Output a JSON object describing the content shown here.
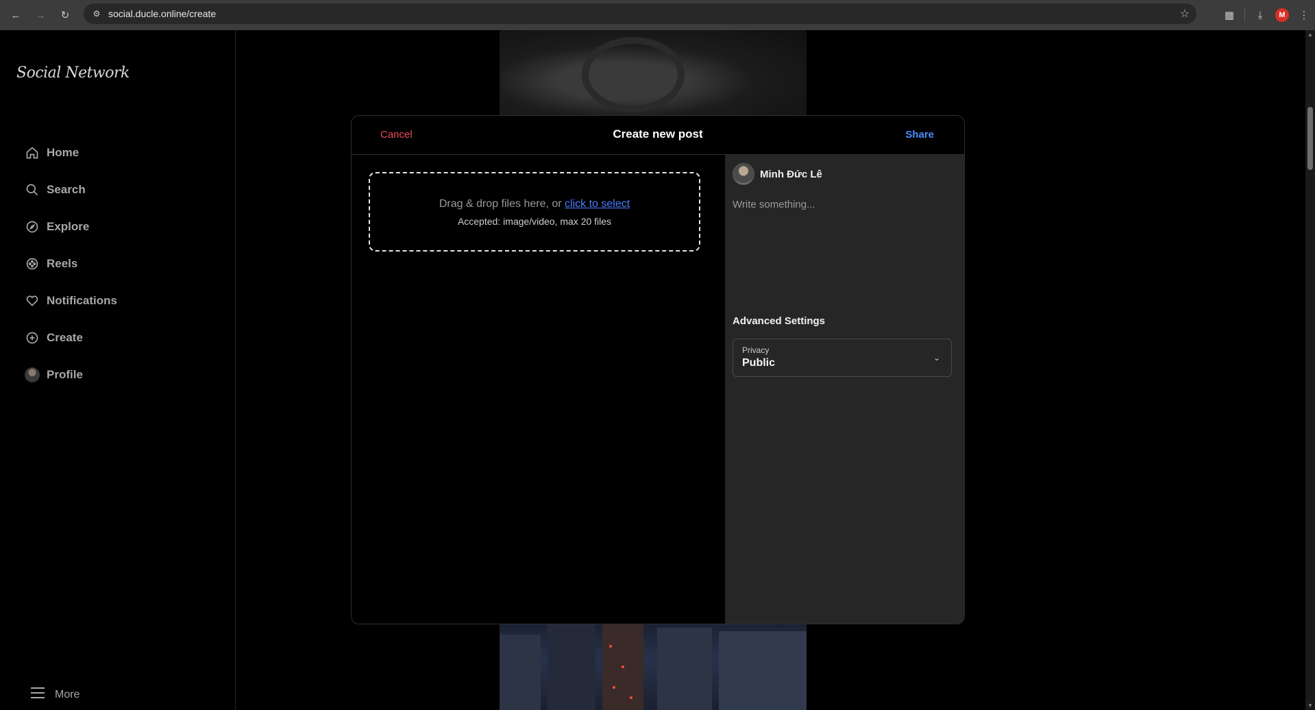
{
  "browser": {
    "url": "social.ducle.online/create",
    "profile_initial": "M"
  },
  "sidebar": {
    "logo": "Social Network",
    "items": [
      {
        "label": "Home"
      },
      {
        "label": "Search"
      },
      {
        "label": "Explore"
      },
      {
        "label": "Reels"
      },
      {
        "label": "Notifications"
      },
      {
        "label": "Create"
      },
      {
        "label": "Profile"
      }
    ],
    "more_label": "More"
  },
  "modal": {
    "cancel_label": "Cancel",
    "title": "Create new post",
    "share_label": "Share",
    "dropzone": {
      "text": "Drag & drop files here, or",
      "link": "click to select",
      "accepted": "Accepted: image/video, max 20 files"
    },
    "user": {
      "name": "Minh Đức Lê"
    },
    "caption_placeholder": "Write something...",
    "advanced_title": "Advanced Settings",
    "privacy": {
      "label": "Privacy",
      "value": "Public"
    }
  },
  "colors": {
    "cancel": "#ed4956",
    "share": "#4a8cff",
    "link": "#4a7cff"
  }
}
